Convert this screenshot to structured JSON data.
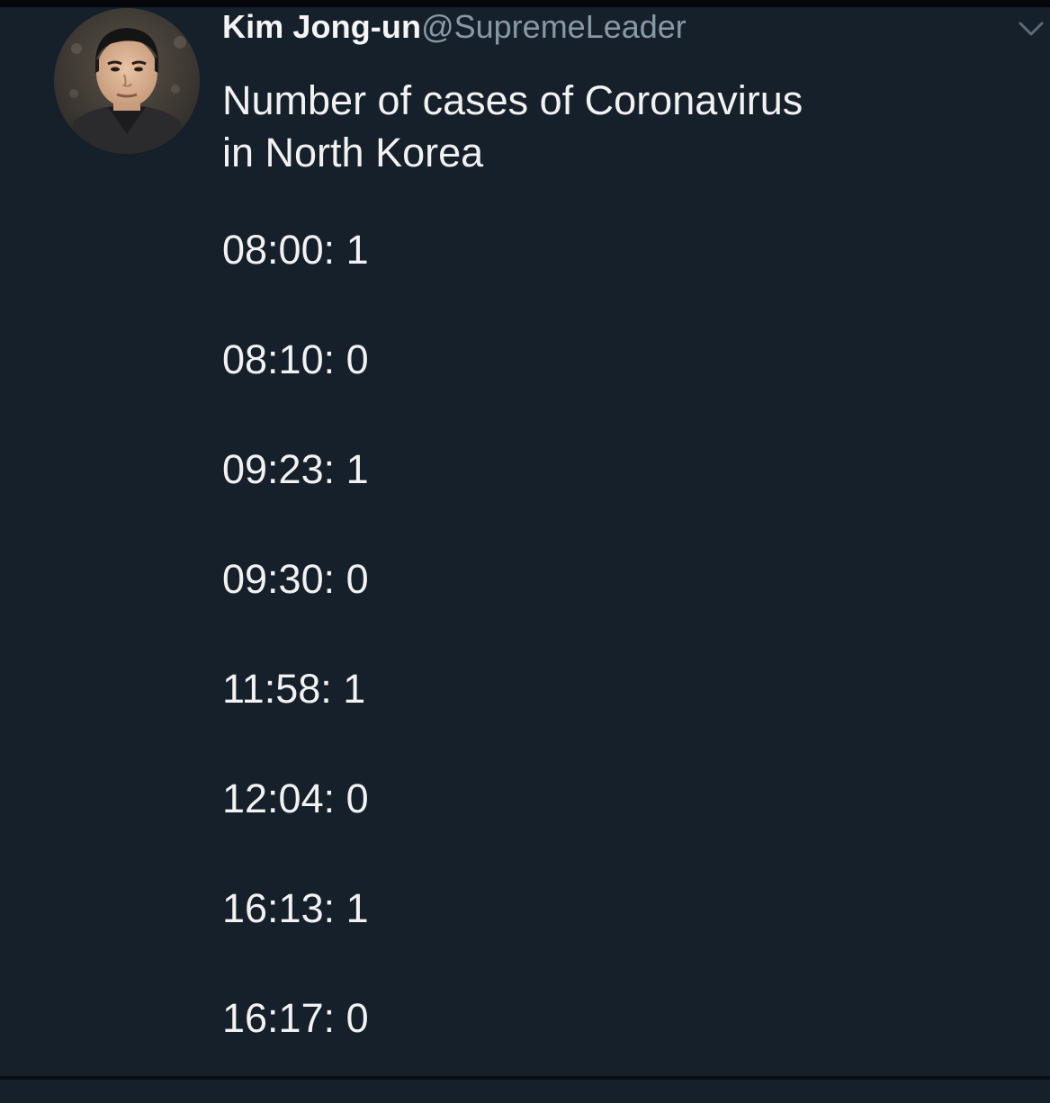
{
  "tweet": {
    "display_name": "Kim Jong-un",
    "handle": "@SupremeLeader",
    "text_lines": [
      "Number of cases of Coronavirus",
      "in North Korea"
    ],
    "entries": [
      "08:00: 1",
      "08:10: 0",
      "09:23: 1",
      "09:30: 0",
      "11:58: 1",
      "12:04: 0",
      "16:13: 1",
      "16:17: 0"
    ]
  },
  "icons": {
    "avatar": "profile-photo",
    "menu": "chevron-down-icon"
  },
  "colors": {
    "background": "#15202b",
    "text": "#f2f2f2",
    "handle": "#8899a6"
  }
}
